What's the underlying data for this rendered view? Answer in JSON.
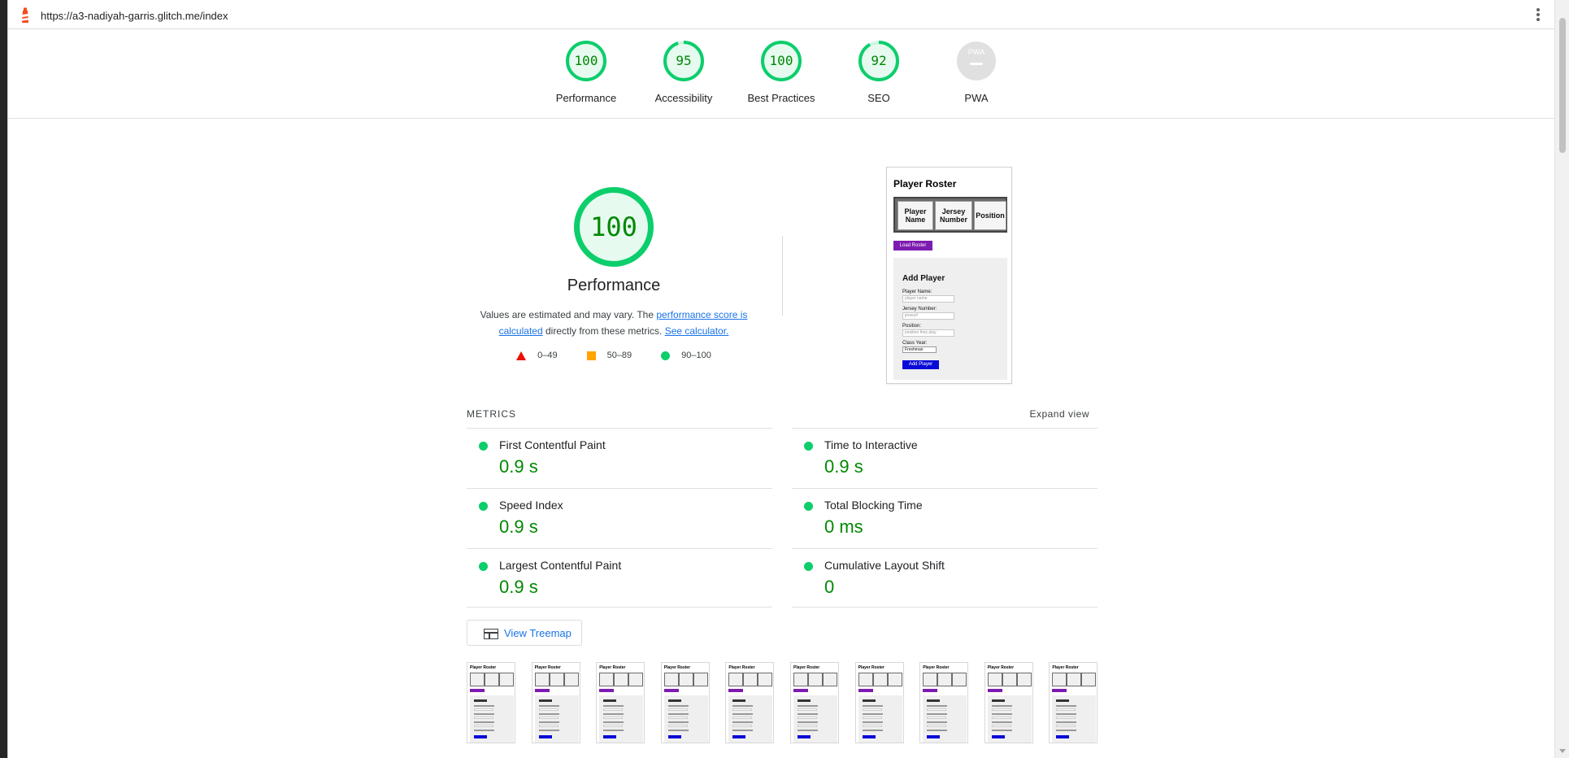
{
  "url": "https://a3-nadiyah-garris.glitch.me/index",
  "colors": {
    "pass": "#0cce6b",
    "pass_text": "#008800",
    "average": "#ffa400",
    "fail": "#eb0f00",
    "link": "#1a73e8",
    "pwa_gray": "#9e9e9e"
  },
  "gauges": [
    {
      "label": "Performance",
      "score": "100",
      "value": 100
    },
    {
      "label": "Accessibility",
      "score": "95",
      "value": 95
    },
    {
      "label": "Best Practices",
      "score": "100",
      "value": 100
    },
    {
      "label": "SEO",
      "score": "92",
      "value": 92
    },
    {
      "label": "PWA",
      "score": "PWA",
      "value": 0
    }
  ],
  "performance": {
    "score": "100",
    "title": "Performance",
    "desc_prefix": "Values are estimated and may vary. The ",
    "desc_link1": "performance score is calculated",
    "desc_middle": " directly from these metrics. ",
    "desc_link2": "See calculator.",
    "legend": [
      {
        "range": "0–49"
      },
      {
        "range": "50–89"
      },
      {
        "range": "90–100"
      }
    ]
  },
  "screenshot": {
    "title": "Player Roster",
    "columns": [
      "Player Name",
      "Jersey Number",
      "Position"
    ],
    "load_button": "Load Roster",
    "form_title": "Add Player",
    "labels": [
      "Player Name:",
      "Jersey Number:",
      "Position:",
      "Class Year:"
    ],
    "placeholders": [
      "player name",
      "jersey#",
      "position they play"
    ],
    "select_value": "Freshman",
    "add_button": "Add Player"
  },
  "metrics": {
    "title": "METRICS",
    "expand": "Expand view",
    "items": [
      {
        "name": "First Contentful Paint",
        "value": "0.9 s"
      },
      {
        "name": "Time to Interactive",
        "value": "0.9 s"
      },
      {
        "name": "Speed Index",
        "value": "0.9 s"
      },
      {
        "name": "Total Blocking Time",
        "value": "0 ms"
      },
      {
        "name": "Largest Contentful Paint",
        "value": "0.9 s"
      },
      {
        "name": "Cumulative Layout Shift",
        "value": "0"
      }
    ]
  },
  "treemap": {
    "label": "View Treemap"
  }
}
